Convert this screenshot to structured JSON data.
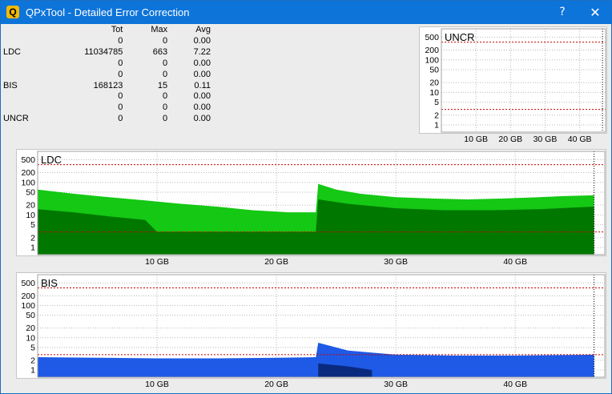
{
  "window": {
    "title": "QPxTool - Detailed Error Correction",
    "app_icon_glyph": "Q",
    "help_glyph": "?",
    "close_glyph": "✕"
  },
  "stats": {
    "headers": [
      "",
      "Tot",
      "Max",
      "Avg"
    ],
    "rows": [
      [
        "",
        "0",
        "0",
        "0.00"
      ],
      [
        "LDC",
        "11034785",
        "663",
        "7.22"
      ],
      [
        "",
        "0",
        "0",
        "0.00"
      ],
      [
        "",
        "0",
        "0",
        "0.00"
      ],
      [
        "BIS",
        "168123",
        "15",
        "0.11"
      ],
      [
        "",
        "0",
        "0",
        "0.00"
      ],
      [
        "",
        "0",
        "0",
        "0.00"
      ],
      [
        "UNCR",
        "0",
        "0",
        "0.00"
      ]
    ]
  },
  "chart_data": [
    {
      "type": "area",
      "title": "UNCR",
      "scale": "log",
      "y_ticks": [
        500,
        200,
        100,
        50,
        20,
        10,
        5,
        2,
        1
      ],
      "x_ticks": [
        "10 GB",
        "20 GB",
        "30 GB",
        "40 GB"
      ],
      "x_tick_values": [
        10,
        20,
        30,
        40
      ],
      "xlim": [
        0,
        47.5
      ],
      "x_end_marker": 46.6,
      "grid": true,
      "series": [
        {
          "values": [
            [
              0,
              0
            ],
            [
              46.6,
              0
            ]
          ],
          "color": "#00aa00"
        }
      ],
      "threshold_lines": [
        {
          "y": 350,
          "color": "#cc0000"
        },
        {
          "y": 3,
          "color": "#cc0000"
        }
      ]
    },
    {
      "type": "area",
      "title": "LDC",
      "scale": "log",
      "y_ticks": [
        500,
        200,
        100,
        50,
        20,
        10,
        5,
        2,
        1
      ],
      "x_ticks": [
        "10 GB",
        "20 GB",
        "30 GB",
        "40 GB"
      ],
      "x_tick_values": [
        10,
        20,
        30,
        40
      ],
      "xlim": [
        0,
        47.5
      ],
      "x_end_marker": 46.6,
      "grid": true,
      "series": [
        {
          "values": [
            [
              0,
              60
            ],
            [
              3,
              45
            ],
            [
              6,
              35
            ],
            [
              9,
              28
            ],
            [
              12,
              22
            ],
            [
              15,
              18
            ],
            [
              18,
              14
            ],
            [
              21,
              12
            ],
            [
              23.3,
              12
            ],
            [
              23.5,
              90
            ],
            [
              25,
              60
            ],
            [
              27,
              45
            ],
            [
              30,
              35
            ],
            [
              33,
              32
            ],
            [
              36,
              30
            ],
            [
              39,
              32
            ],
            [
              42,
              35
            ],
            [
              44,
              38
            ],
            [
              46.6,
              40
            ]
          ],
          "color": "#14c814"
        },
        {
          "values": [
            [
              0,
              15
            ],
            [
              3,
              12
            ],
            [
              6,
              9
            ],
            [
              9,
              7
            ],
            [
              10,
              3
            ],
            [
              12,
              3
            ],
            [
              15,
              3
            ],
            [
              18,
              3
            ],
            [
              21,
              3
            ],
            [
              23.3,
              3
            ],
            [
              23.5,
              30
            ],
            [
              26,
              22
            ],
            [
              30,
              16
            ],
            [
              34,
              14
            ],
            [
              38,
              14
            ],
            [
              42,
              15
            ],
            [
              46.6,
              18
            ]
          ],
          "color": "#007800"
        }
      ],
      "threshold_lines": [
        {
          "y": 350,
          "color": "#cc0000"
        },
        {
          "y": 3,
          "color": "#cc0000"
        }
      ]
    },
    {
      "type": "area",
      "title": "BIS",
      "scale": "log",
      "y_ticks": [
        500,
        200,
        100,
        50,
        20,
        10,
        5,
        2,
        1
      ],
      "x_ticks": [
        "10 GB",
        "20 GB",
        "30 GB",
        "40 GB"
      ],
      "x_tick_values": [
        10,
        20,
        30,
        40
      ],
      "xlim": [
        0,
        47.5
      ],
      "x_end_marker": 46.6,
      "grid": true,
      "series": [
        {
          "values": [
            [
              0,
              2.5
            ],
            [
              5,
              2.4
            ],
            [
              10,
              2.3
            ],
            [
              15,
              2.3
            ],
            [
              20,
              2.4
            ],
            [
              23.3,
              2.5
            ],
            [
              23.5,
              7
            ],
            [
              26,
              4
            ],
            [
              30,
              3
            ],
            [
              35,
              2.8
            ],
            [
              40,
              2.8
            ],
            [
              46.6,
              3
            ]
          ],
          "color": "#1e5ae6"
        },
        {
          "values": [
            [
              23.5,
              1.6
            ],
            [
              26,
              1.3
            ],
            [
              28,
              1
            ]
          ],
          "color": "#0a2a80"
        }
      ],
      "threshold_lines": [
        {
          "y": 350,
          "color": "#cc0000"
        },
        {
          "y": 3,
          "color": "#cc0000"
        }
      ]
    }
  ]
}
